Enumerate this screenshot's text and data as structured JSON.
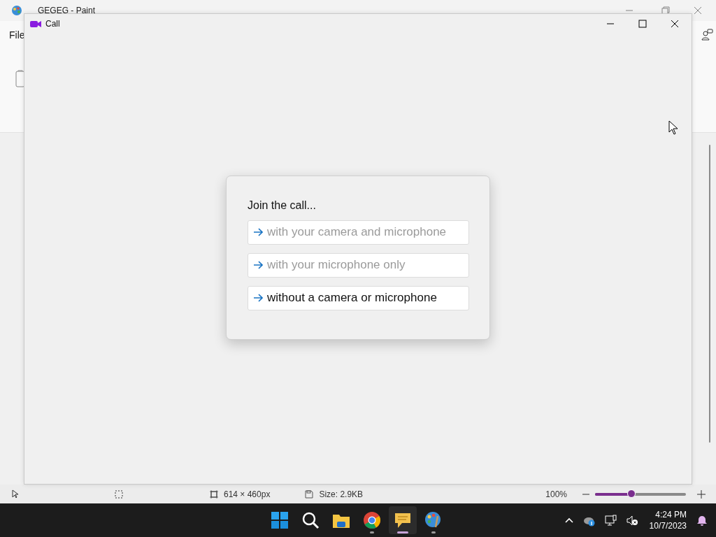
{
  "paint": {
    "title": "GEGEG - Paint",
    "menu": [
      {
        "label": "File"
      }
    ],
    "status_bar": {
      "canvas_size": "614 × 460px",
      "file_size": "Size: 2.9KB",
      "zoom": "100%",
      "zoom_slider": {
        "level": 0.38
      }
    }
  },
  "call_window": {
    "title": "Call",
    "dialog": {
      "heading": "Join the call...",
      "options": [
        {
          "label": "with your camera and microphone",
          "disabled": true
        },
        {
          "label": "with your microphone only",
          "disabled": true
        },
        {
          "label": "without a camera or microphone",
          "disabled": false
        }
      ]
    }
  },
  "taskbar": {
    "apps": [
      {
        "kind": "start",
        "selected": false,
        "running": false
      },
      {
        "kind": "search",
        "selected": false,
        "running": false
      },
      {
        "kind": "folder",
        "selected": false,
        "running": false
      },
      {
        "kind": "browser",
        "selected": false,
        "running": true
      },
      {
        "kind": "chat",
        "selected": true,
        "running": true
      },
      {
        "kind": "paint",
        "selected": false,
        "running": true
      }
    ],
    "clock": {
      "time": "4:24 PM",
      "date": "10/7/2023"
    }
  }
}
